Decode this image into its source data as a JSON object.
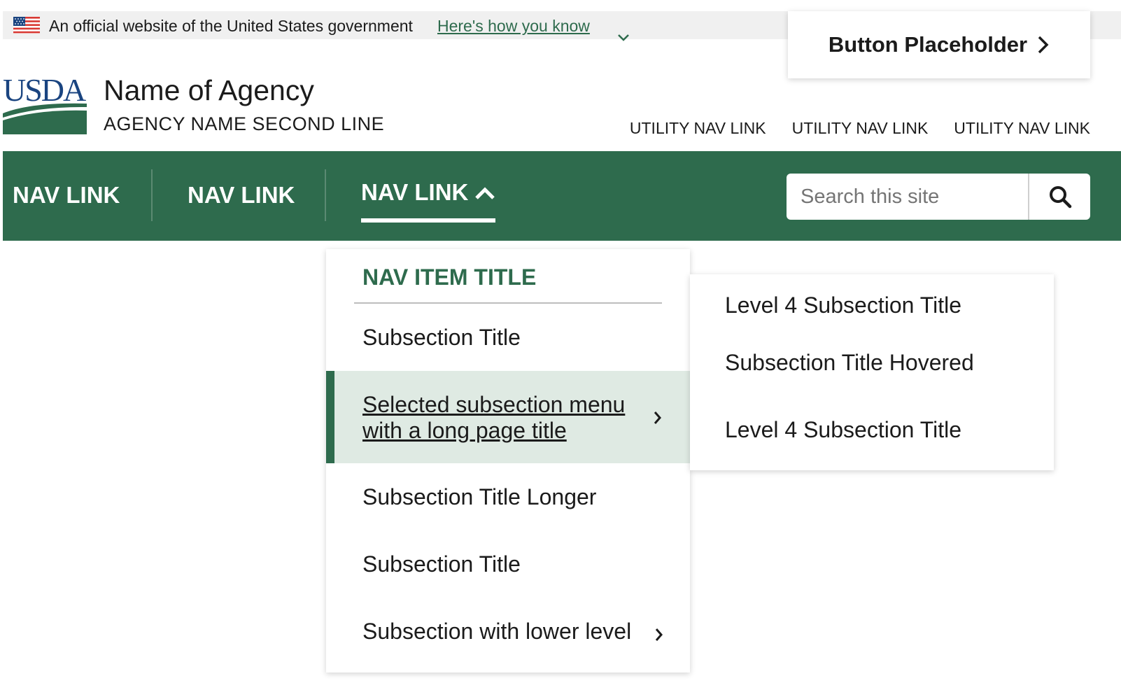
{
  "gov_banner": {
    "text": "An official website of the United States government",
    "link": "Here's how you know",
    "flag_icon": "us-flag-icon"
  },
  "header": {
    "cta_label": "Button Placeholder",
    "logo_text": "USDA",
    "agency_name": "Name of Agency",
    "agency_second_line": "AGENCY NAME SECOND LINE",
    "utility_links": [
      "UTILITY NAV LINK",
      "UTILITY NAV LINK",
      "UTILITY NAV LINK"
    ]
  },
  "nav": {
    "links": [
      "NAV LINK",
      "NAV LINK",
      "NAV LINK"
    ],
    "active_index": 2,
    "search_placeholder": "Search this site",
    "colors": {
      "primary": "#2e6b4d",
      "selected_bg": "#dfeae3"
    }
  },
  "mega_menu": {
    "title": "NAV ITEM TITLE",
    "items": [
      "Subsection Title",
      "Selected subsection menu with a long page title",
      "Subsection Title Longer",
      "Subsection Title",
      "Subsection with lower level"
    ],
    "selected_index": 1
  },
  "submenu": {
    "items": [
      "Level 4 Subsection Title",
      "Subsection Title Hovered",
      "Level 4 Subsection Title"
    ]
  }
}
